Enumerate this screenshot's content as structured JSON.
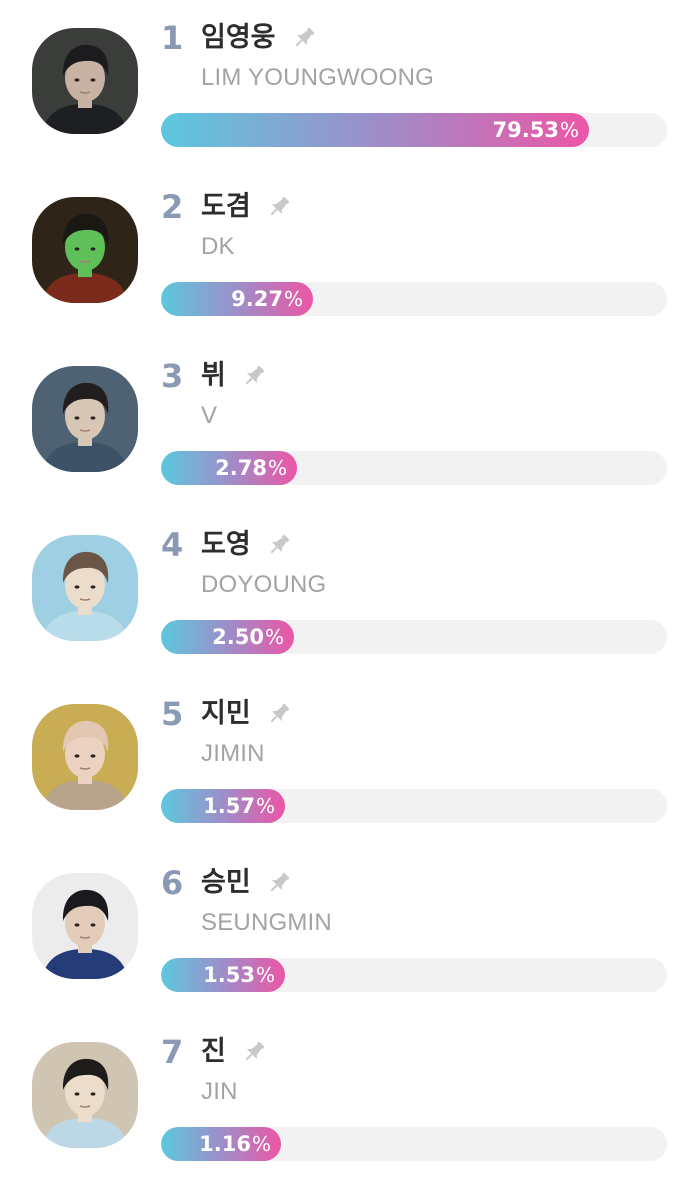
{
  "candidates": [
    {
      "rank": "1",
      "name_ko": "임영웅",
      "name_en": "LIM YOUNGWOONG",
      "percent": "79.53",
      "share": 79.53,
      "pin_icon": "pin-icon",
      "avatar": {
        "bg": "#3a3d3a",
        "skin": "#c8b2a4",
        "hair": "#1c1c1e",
        "clothes": "#1e1f22"
      }
    },
    {
      "rank": "2",
      "name_ko": "도겸",
      "name_en": "DK",
      "percent": "9.27",
      "share": 9.27,
      "pin_icon": "pin-icon",
      "avatar": {
        "bg": "#2f2418",
        "skin": "#5fbf58",
        "hair": "#1a1812",
        "clothes": "#7a2b1c"
      }
    },
    {
      "rank": "3",
      "name_ko": "뷔",
      "name_en": "V",
      "percent": "2.78",
      "share": 2.78,
      "pin_icon": "pin-icon",
      "avatar": {
        "bg": "#4f6274",
        "skin": "#d8c6b6",
        "hair": "#221e1e",
        "clothes": "#3d5266"
      }
    },
    {
      "rank": "4",
      "name_ko": "도영",
      "name_en": "DOYOUNG",
      "percent": "2.50",
      "share": 2.5,
      "pin_icon": "pin-icon",
      "avatar": {
        "bg": "#9fcfe2",
        "skin": "#ecdccc",
        "hair": "#6a5646",
        "clothes": "#b9dceb"
      }
    },
    {
      "rank": "5",
      "name_ko": "지민",
      "name_en": "JIMIN",
      "percent": "1.57",
      "share": 1.57,
      "pin_icon": "pin-icon",
      "avatar": {
        "bg": "#c8ad55",
        "skin": "#ecd2c0",
        "hair": "#e4c7b2",
        "clothes": "#b8a48a"
      }
    },
    {
      "rank": "6",
      "name_ko": "승민",
      "name_en": "SEUNGMIN",
      "percent": "1.53",
      "share": 1.53,
      "pin_icon": "pin-icon",
      "avatar": {
        "bg": "#ececec",
        "skin": "#e2cbb9",
        "hair": "#1a1a1e",
        "clothes": "#253c78"
      }
    },
    {
      "rank": "7",
      "name_ko": "진",
      "name_en": "JIN",
      "percent": "1.16",
      "share": 1.16,
      "pin_icon": "pin-icon",
      "avatar": {
        "bg": "#d0c4b2",
        "skin": "#ecdccb",
        "hair": "#1e1b1b",
        "clothes": "#bcd7e6"
      }
    }
  ],
  "percent_sign": "%",
  "colors": {
    "bar_start": "#5cc8de",
    "bar_mid": "#9d8ec9",
    "bar_end": "#ec56a6",
    "track": "#f2f2f2",
    "rank": "#8a99b4",
    "name_ko": "#2d2d2d",
    "name_en": "#a3a3a3",
    "pin": "#c8c8c8"
  }
}
